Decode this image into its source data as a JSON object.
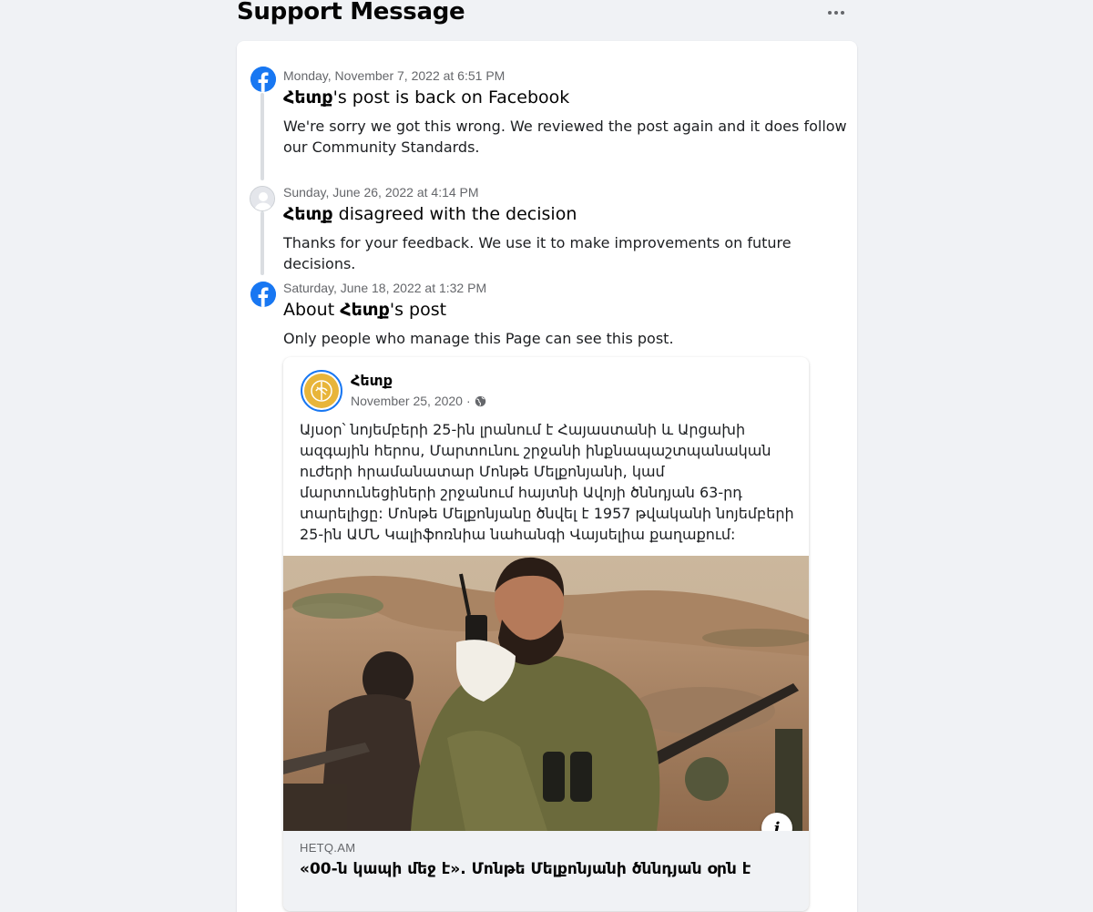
{
  "header": {
    "title": "Support Message",
    "more_icon": "more-horizontal-icon"
  },
  "timeline": [
    {
      "icon": "facebook-icon",
      "timestamp": "Monday, November 7, 2022 at 6:51 PM",
      "title_bold": "Հետք",
      "title_rest": "'s post is back on Facebook",
      "body": "We're sorry we got this wrong. We reviewed the post again and it does follow our Community Standards."
    },
    {
      "icon": "user-avatar-icon",
      "timestamp": "Sunday, June 26, 2022 at 4:14 PM",
      "title_bold": "Հետք",
      "title_rest": " disagreed with the decision",
      "body": "Thanks for your feedback. We use it to make improvements on future decisions."
    },
    {
      "icon": "facebook-icon",
      "timestamp": "Saturday, June 18, 2022 at 1:32 PM",
      "title_prefix": "About ",
      "title_bold": "Հետք",
      "title_rest": "'s post",
      "body": "Only people who manage this Page can see this post."
    }
  ],
  "post": {
    "page_name": "Հետք",
    "date": "November 25, 2020",
    "separator": "·",
    "privacy_icon": "globe-icon",
    "text": "Այսօր՝ նոյեմբերի 25-ին լրանում է Հայաստանի և Արցախի ազգային հերոս, Մարտունու շրջանի ինքնապաշտպանական ուժերի հրամանատար Մոնթե Մելքոնյանի, կամ մարտունեցիների շրջանում հայտնի Ավոյի ծննդյան 63-րդ տարելիցը: Մոնթե Մելքոնյանը ծնվել է 1957 թվականի նոյեմբերի 25-ին ԱՄՆ Կալիֆոռնիա նահանգի Վայսելիա քաղաքում:",
    "image_icon": "photo-soldier-radio",
    "info_label": "i",
    "link": {
      "domain": "HETQ.AM",
      "title": "«00-ն կապի մեջ է». Մոնթե Մելքոնյանի ծննդյան օրն է"
    }
  },
  "colors": {
    "background": "#f0f2f5",
    "card": "#ffffff",
    "facebook_blue": "#1877f2",
    "secondary_text": "#65676b"
  }
}
